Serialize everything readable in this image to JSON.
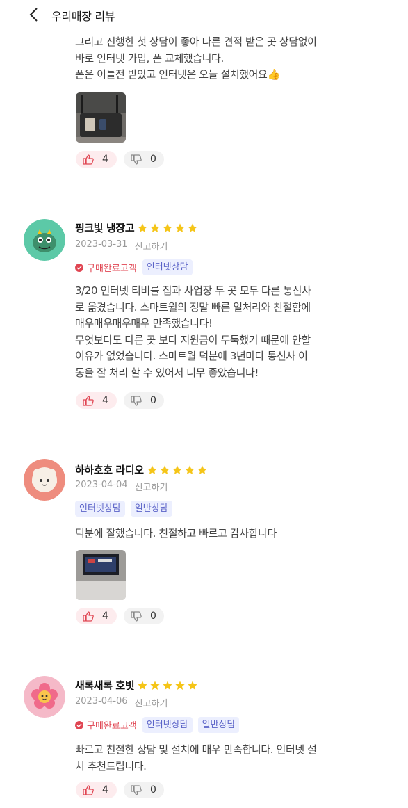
{
  "header": {
    "title": "우리매장 리뷰"
  },
  "top_review": {
    "text": "그리고 진행한 첫 상담이 좋아 다른 견적 받은 곳 상담없이\n바로 인터넷 가입, 폰 교체했습니다.\n폰은 이틀전 받았고 인터넷은 오늘 설치했어요",
    "emoji": "👍",
    "likes": "4",
    "dislikes": "0"
  },
  "reviews": [
    {
      "nickname": "핑크빛 냉장고",
      "rating": 5,
      "date": "2023-03-31",
      "report_label": "신고하기",
      "verified_label": "구매완료고객",
      "tags": [
        "인터넷상담"
      ],
      "text": "3/20 인터넷 티비를 집과 사업장 두 곳 모두 다른 통신사\n로 옮겼습니다. 스마트월의 정말 빠른 일처리와 친절함에\n매우매우매우매우 만족했습니다!\n 무엇보다도 다른 곳 보다 지원금이 두둑했기 때문에 안할\n이유가 없었습니다. 스마트월 덕분에 3년마다 통신사 이\n동을 잘 처리 할 수 있어서 너무 좋았습니다!",
      "likes": "4",
      "dislikes": "0",
      "avatar_color": "#5cc9a7"
    },
    {
      "nickname": "하하호호 라디오",
      "rating": 5,
      "date": "2023-04-04",
      "report_label": "신고하기",
      "tags": [
        "인터넷상담",
        "일반상담"
      ],
      "text": "덕분에 잘했습니다. 친절하고 빠르고 감사합니다",
      "likes": "4",
      "dislikes": "0",
      "avatar_color": "#ee8c7e"
    },
    {
      "nickname": "새록새록 호빗",
      "rating": 5,
      "date": "2023-04-06",
      "report_label": "신고하기",
      "verified_label": "구매완료고객",
      "tags": [
        "인터넷상담",
        "일반상담"
      ],
      "text": "빠르고 친절한 상담 및 설치에 매우 만족합니다. 인터넷 설\n치 추천드립니다.",
      "likes": "4",
      "dislikes": "0",
      "avatar_color": "#f5b9c8"
    }
  ],
  "colors": {
    "star": "#f5c518",
    "verified": "#e04552",
    "tag_bg": "#eceffe",
    "tag_text": "#5b63c8",
    "like_bg": "#fdecee",
    "dislike_bg": "#f2f2f2"
  }
}
